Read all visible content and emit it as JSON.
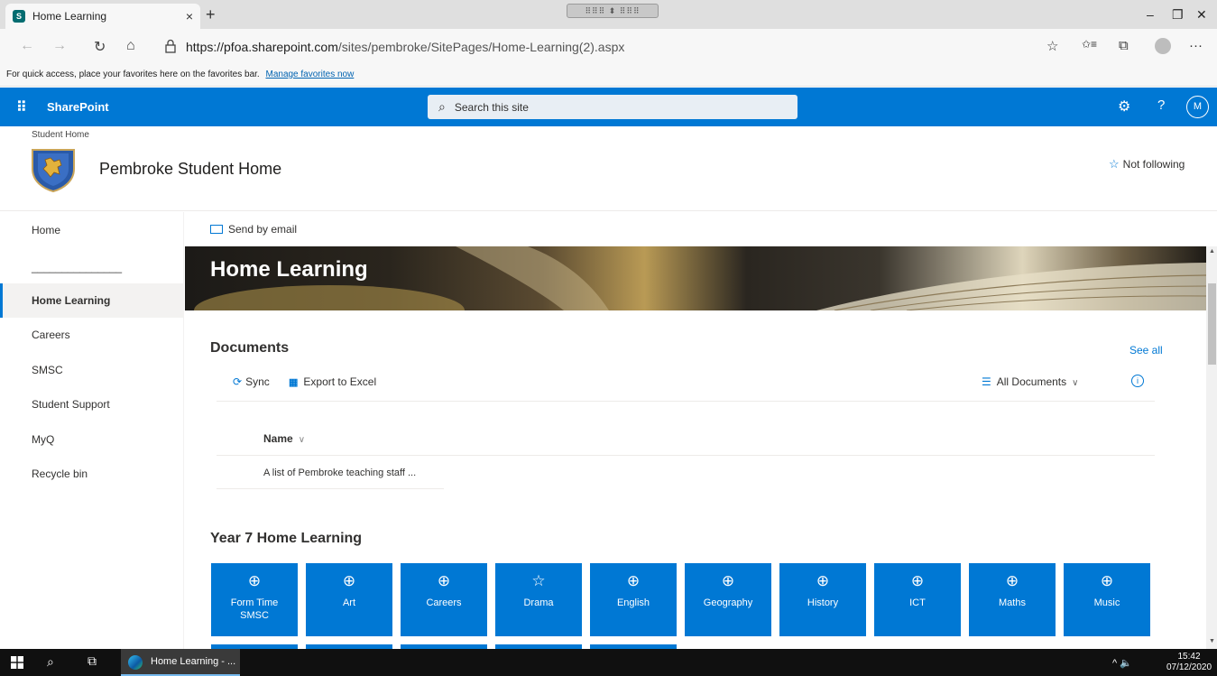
{
  "browser": {
    "tab_title": "Home Learning",
    "tab_close": "×",
    "new_tab": "+",
    "drag_pill": "⠿⠿⠿ ⬍ ⠿⠿⠿",
    "url_host": "https://pfoa.sharepoint.com",
    "url_path": "/sites/pembroke/SitePages/Home-Learning(2).aspx",
    "minimize": "–",
    "restore": "❐",
    "close": "✕",
    "back_icon": "←",
    "forward_icon": "→",
    "refresh_icon": "↻",
    "home_icon": "⌂",
    "fav_star_icon": "☆",
    "favorites_icon": "✩≡",
    "collections_icon": "⧉",
    "more_icon": "···",
    "favorites_bar_text": "For quick access, place your favorites here on the favorites bar.",
    "favorites_bar_link": "Manage favorites now"
  },
  "suite": {
    "waffle_icon": "⠿",
    "app_name": "SharePoint",
    "search_placeholder": "Search this site",
    "search_icon": "⌕",
    "settings_icon": "⚙",
    "help_icon": "?",
    "user_initial": "M"
  },
  "site": {
    "breadcrumb": "Student Home",
    "name": "Pembroke Student Home",
    "follow_label": "Not following",
    "follow_icon": "☆"
  },
  "nav": [
    {
      "label": "Home",
      "selected": false
    },
    {
      "label": "_______________",
      "selected": false
    },
    {
      "label": "Home Learning",
      "selected": true
    },
    {
      "label": "Careers",
      "selected": false
    },
    {
      "label": "SMSC",
      "selected": false
    },
    {
      "label": "Student Support",
      "selected": false
    },
    {
      "label": "MyQ",
      "selected": false
    },
    {
      "label": "Recycle bin",
      "selected": false
    }
  ],
  "command": {
    "send_email": "Send by email"
  },
  "hero": {
    "title": "Home Learning"
  },
  "documents": {
    "title": "Documents",
    "see_all": "See all",
    "sync_label": "Sync",
    "export_label": "Export to Excel",
    "view_label": "All Documents",
    "info_icon": "i",
    "column_name": "Name",
    "rows": [
      "A list of Pembroke teaching staff ..."
    ]
  },
  "year7": {
    "title": "Year 7 Home Learning",
    "tiles": [
      {
        "label": "Form Time SMSC",
        "icon": "globe"
      },
      {
        "label": "Art",
        "icon": "globe"
      },
      {
        "label": "Careers",
        "icon": "globe"
      },
      {
        "label": "Drama",
        "icon": "star"
      },
      {
        "label": "English",
        "icon": "globe"
      },
      {
        "label": "Geography",
        "icon": "globe"
      },
      {
        "label": "History",
        "icon": "globe"
      },
      {
        "label": "ICT",
        "icon": "globe"
      },
      {
        "label": "Maths",
        "icon": "globe"
      },
      {
        "label": "Music",
        "icon": "globe"
      }
    ],
    "second_row_tile_count": 5
  },
  "taskbar": {
    "edge_label": "Home Learning - ...",
    "tray_icons": "^ 🔈",
    "time": "15:42",
    "date": "07/12/2020"
  },
  "colors": {
    "brand": "#0078d4",
    "taskbar": "#101010"
  }
}
